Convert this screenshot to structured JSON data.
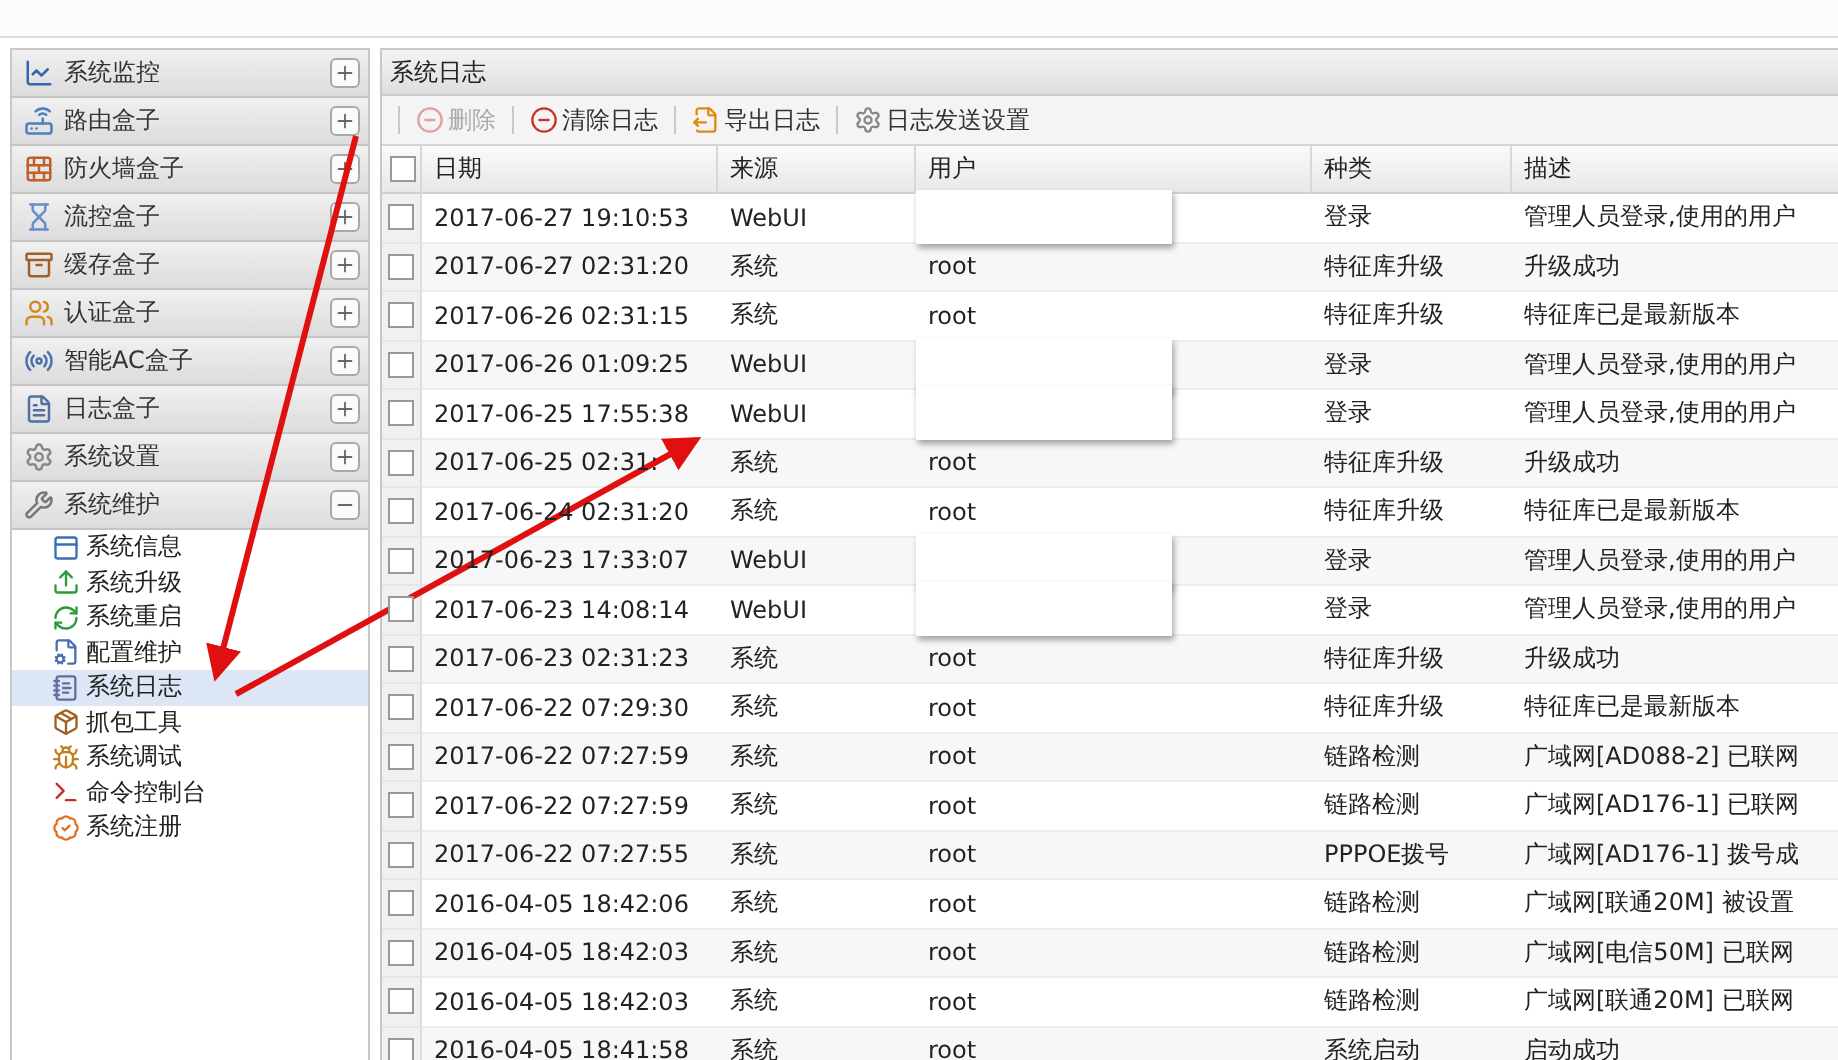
{
  "sidebar": {
    "sections": [
      {
        "label": "系统监控",
        "expanded": false
      },
      {
        "label": "路由盒子",
        "expanded": false
      },
      {
        "label": "防火墙盒子",
        "expanded": false
      },
      {
        "label": "流控盒子",
        "expanded": false
      },
      {
        "label": "缓存盒子",
        "expanded": false
      },
      {
        "label": "认证盒子",
        "expanded": false
      },
      {
        "label": "智能AC盒子",
        "expanded": false
      },
      {
        "label": "日志盒子",
        "expanded": false
      },
      {
        "label": "系统设置",
        "expanded": false
      },
      {
        "label": "系统维护",
        "expanded": true,
        "children": [
          {
            "label": "系统信息",
            "selected": false
          },
          {
            "label": "系统升级",
            "selected": false
          },
          {
            "label": "系统重启",
            "selected": false
          },
          {
            "label": "配置维护",
            "selected": false
          },
          {
            "label": "系统日志",
            "selected": true
          },
          {
            "label": "抓包工具",
            "selected": false
          },
          {
            "label": "系统调试",
            "selected": false
          },
          {
            "label": "命令控制台",
            "selected": false
          },
          {
            "label": "系统注册",
            "selected": false
          }
        ]
      }
    ]
  },
  "panel": {
    "title": "系统日志",
    "toolbar": [
      {
        "label": "删除",
        "disabled": true
      },
      {
        "label": "清除日志",
        "disabled": false
      },
      {
        "label": "导出日志",
        "disabled": false
      },
      {
        "label": "日志发送设置",
        "disabled": false
      }
    ],
    "table": {
      "all_checked": false,
      "columns": [
        "日期",
        "来源",
        "用户",
        "种类",
        "描述"
      ],
      "rows": [
        {
          "checked": false,
          "redacted": true,
          "cells": [
            "2017-06-27 19:10:53",
            "WebUI",
            "",
            "登录",
            "管理人员登录,使用的用户"
          ]
        },
        {
          "checked": false,
          "redacted": false,
          "cells": [
            "2017-06-27 02:31:20",
            "系统",
            "root",
            "特征库升级",
            "升级成功"
          ]
        },
        {
          "checked": false,
          "redacted": false,
          "cells": [
            "2017-06-26 02:31:15",
            "系统",
            "root",
            "特征库升级",
            "特征库已是最新版本"
          ]
        },
        {
          "checked": false,
          "redacted": true,
          "cells": [
            "2017-06-26 01:09:25",
            "WebUI",
            "",
            "登录",
            "管理人员登录,使用的用户"
          ]
        },
        {
          "checked": false,
          "redacted": true,
          "cells": [
            "2017-06-25 17:55:38",
            "WebUI",
            "",
            "登录",
            "管理人员登录,使用的用户"
          ]
        },
        {
          "checked": false,
          "redacted": false,
          "cells": [
            "2017-06-25 02:31:",
            "系统",
            "root",
            "特征库升级",
            "升级成功"
          ]
        },
        {
          "checked": false,
          "redacted": false,
          "cells": [
            "2017-06-24 02:31:20",
            "系统",
            "root",
            "特征库升级",
            "特征库已是最新版本"
          ]
        },
        {
          "checked": false,
          "redacted": true,
          "cells": [
            "2017-06-23 17:33:07",
            "WebUI",
            "",
            "登录",
            "管理人员登录,使用的用户"
          ]
        },
        {
          "checked": false,
          "redacted": true,
          "cells": [
            "2017-06-23 14:08:14",
            "WebUI",
            "",
            "登录",
            "管理人员登录,使用的用户"
          ]
        },
        {
          "checked": false,
          "redacted": false,
          "cells": [
            "2017-06-23 02:31:23",
            "系统",
            "root",
            "特征库升级",
            "升级成功"
          ]
        },
        {
          "checked": false,
          "redacted": false,
          "cells": [
            "2017-06-22 07:29:30",
            "系统",
            "root",
            "特征库升级",
            "特征库已是最新版本"
          ]
        },
        {
          "checked": false,
          "redacted": false,
          "cells": [
            "2017-06-22 07:27:59",
            "系统",
            "root",
            "链路检测",
            "广域网[AD088-2] 已联网"
          ]
        },
        {
          "checked": false,
          "redacted": false,
          "cells": [
            "2017-06-22 07:27:59",
            "系统",
            "root",
            "链路检测",
            "广域网[AD176-1] 已联网"
          ]
        },
        {
          "checked": false,
          "redacted": false,
          "cells": [
            "2017-06-22 07:27:55",
            "系统",
            "root",
            "PPPOE拨号",
            "广域网[AD176-1] 拨号成"
          ]
        },
        {
          "checked": false,
          "redacted": false,
          "cells": [
            "2016-04-05 18:42:06",
            "系统",
            "root",
            "链路检测",
            "广域网[联通20M] 被设置"
          ]
        },
        {
          "checked": false,
          "redacted": false,
          "cells": [
            "2016-04-05 18:42:03",
            "系统",
            "root",
            "链路检测",
            "广域网[电信50M] 已联网"
          ]
        },
        {
          "checked": false,
          "redacted": false,
          "cells": [
            "2016-04-05 18:42:03",
            "系统",
            "root",
            "链路检测",
            "广域网[联通20M] 已联网"
          ]
        },
        {
          "checked": false,
          "redacted": false,
          "cells": [
            "2016-04-05 18:41:58",
            "系统",
            "root",
            "系统启动",
            "启动成功"
          ]
        }
      ]
    }
  },
  "annotations": [
    {
      "kind": "arrow"
    },
    {
      "kind": "arrow"
    }
  ]
}
